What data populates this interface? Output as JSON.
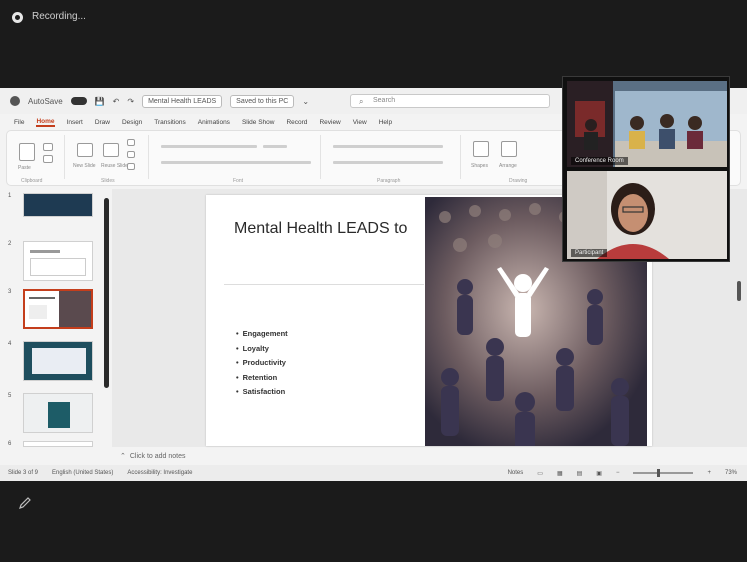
{
  "recording": {
    "label": "Recording..."
  },
  "titlebar": {
    "autosave": "AutoSave",
    "autosave_state": "On",
    "filename": "Mental Health LEADS",
    "saved_state": "Saved to this PC",
    "search_placeholder": "Search"
  },
  "menu": [
    "File",
    "Home",
    "Insert",
    "Draw",
    "Design",
    "Transitions",
    "Animations",
    "Slide Show",
    "Record",
    "Review",
    "View",
    "Help"
  ],
  "menu_active": "Home",
  "ribbon": {
    "groups": [
      "Clipboard",
      "Slides",
      "Font",
      "Paragraph",
      "Drawing"
    ],
    "paste": "Paste",
    "new_slide": "New Slide",
    "reuse_slides": "Reuse Slides",
    "shapes": "Shapes",
    "arrange": "Arrange"
  },
  "thumbnails": [
    {
      "num": "1"
    },
    {
      "num": "2"
    },
    {
      "num": "3"
    },
    {
      "num": "4"
    },
    {
      "num": "5"
    },
    {
      "num": "6"
    }
  ],
  "slide": {
    "title": "Mental Health LEADS to",
    "bullets": [
      "Engagement",
      "Loyalty",
      "Productivity",
      "Retention",
      "Satisfaction"
    ]
  },
  "notes": {
    "label": "Click to add notes"
  },
  "status": {
    "slide_counter": "Slide 3 of 9",
    "language": "English (United States)",
    "accessibility": "Accessibility: Investigate",
    "notes_btn": "Notes",
    "zoom": "73%"
  },
  "video": {
    "tile1_name": "Conference Room",
    "tile2_name": "Participant"
  },
  "colors": {
    "accent": "#c43e1c",
    "slide_dark": "#1e3a52"
  }
}
